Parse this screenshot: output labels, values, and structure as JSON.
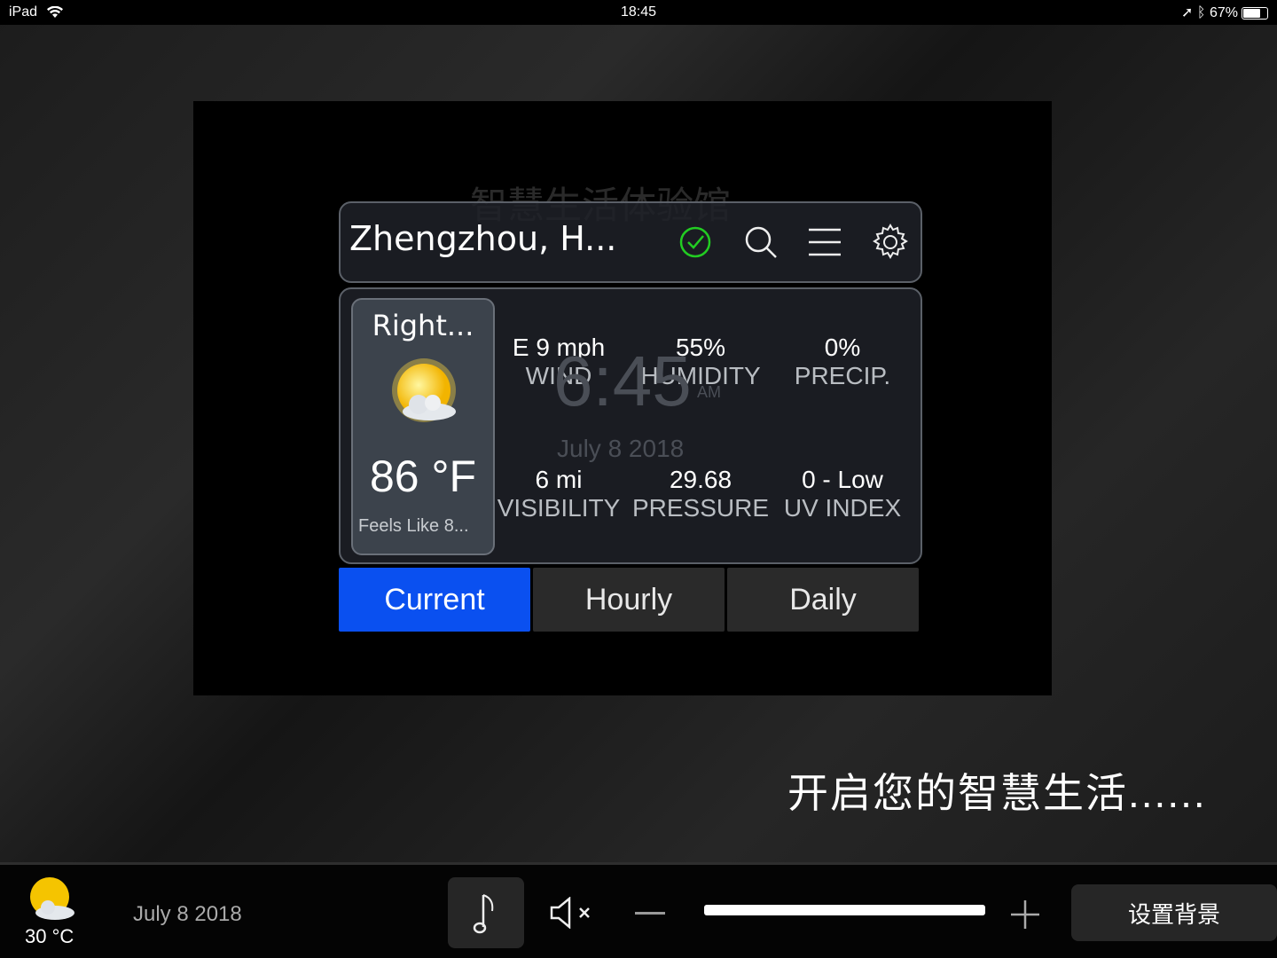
{
  "status_bar": {
    "device": "iPad",
    "time": "18:45",
    "battery": "67%",
    "battery_level": 0.67
  },
  "background": {
    "title": "智慧生活体验馆",
    "clock": "6:45",
    "ampm": "AM",
    "date": "July 8 2018"
  },
  "weather": {
    "location": "Zhengzhou, H...",
    "icons": [
      "check-circle-icon",
      "search-icon",
      "menu-icon",
      "gear-icon"
    ],
    "current": {
      "label": "Right...",
      "temperature": "86 °F",
      "feels_like": "Feels Like  8..."
    },
    "stats": [
      {
        "value": "E 9 mph",
        "label": "WIND"
      },
      {
        "value": "55%",
        "label": "HUMIDITY"
      },
      {
        "value": "0%",
        "label": "PRECIP."
      },
      {
        "value": "6 mi",
        "label": "VISIBILITY"
      },
      {
        "value": "29.68",
        "label": "PRESSURE"
      },
      {
        "value": "0 - Low",
        "label": "UV INDEX"
      }
    ],
    "tabs": [
      {
        "label": "Current",
        "active": true
      },
      {
        "label": "Hourly"
      },
      {
        "label": "Daily"
      }
    ],
    "accent": "#0a50f0"
  },
  "slogan": "开启您的智慧生活......",
  "bottom_bar": {
    "temperature": "30 °C",
    "date": "July 8 2018",
    "volume": 1.0,
    "set_background": "设置背景"
  }
}
